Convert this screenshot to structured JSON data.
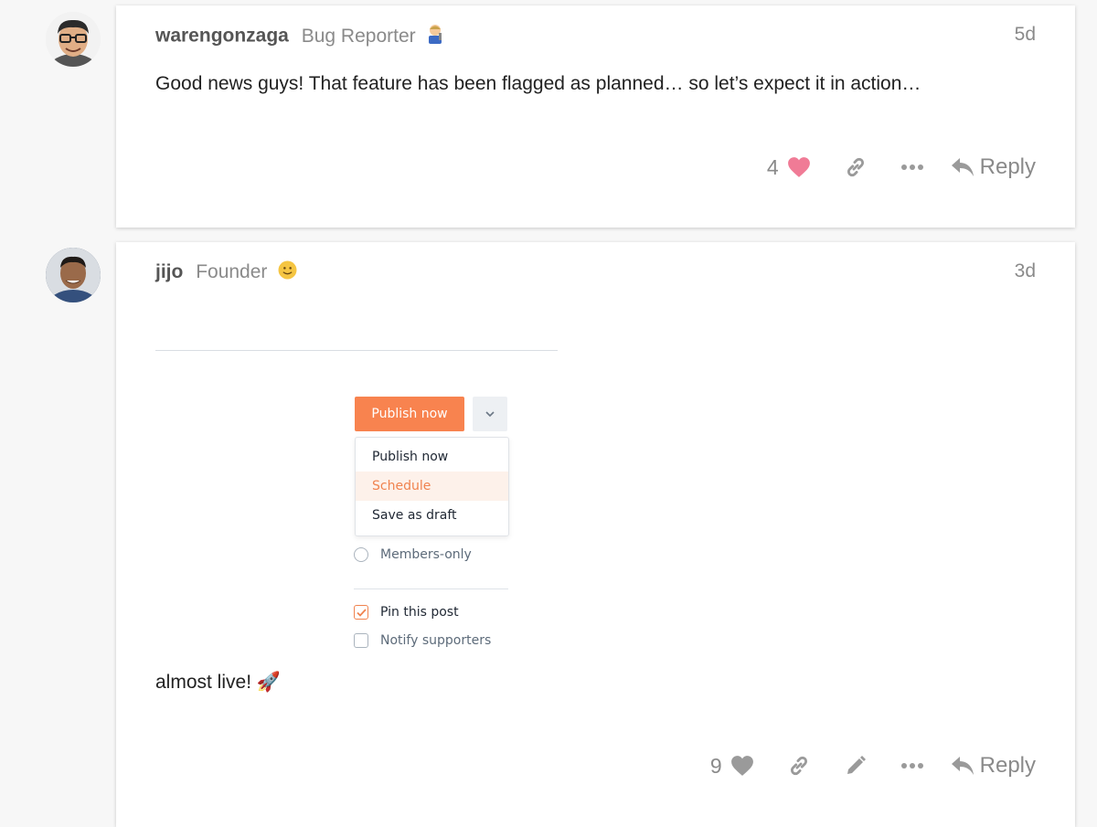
{
  "posts": [
    {
      "username": "warengonzaga",
      "user_title": "Bug Reporter",
      "title_emoji": "mechanic",
      "date": "5d",
      "text": "Good news guys! That feature has been flagged as planned… so let’s expect it in action…",
      "like_count": "4",
      "liked": true,
      "reply_label": "Reply"
    },
    {
      "username": "jijo",
      "user_title": "Founder",
      "title_emoji": "slightly-smiling-face",
      "date": "3d",
      "text": "almost live! 🚀",
      "like_count": "9",
      "liked": false,
      "reply_label": "Reply",
      "embed": {
        "publish_button": "Publish now",
        "menu_items": [
          "Publish now",
          "Schedule",
          "Save as draft"
        ],
        "active_menu_item": "Schedule",
        "members_only": "Members-only",
        "pin_post": "Pin this post",
        "notify": "Notify supporters"
      }
    }
  ],
  "colors": {
    "like_active": "#f07b96",
    "icon_gray": "#9a9a9a",
    "accent_orange": "#f8834f"
  }
}
